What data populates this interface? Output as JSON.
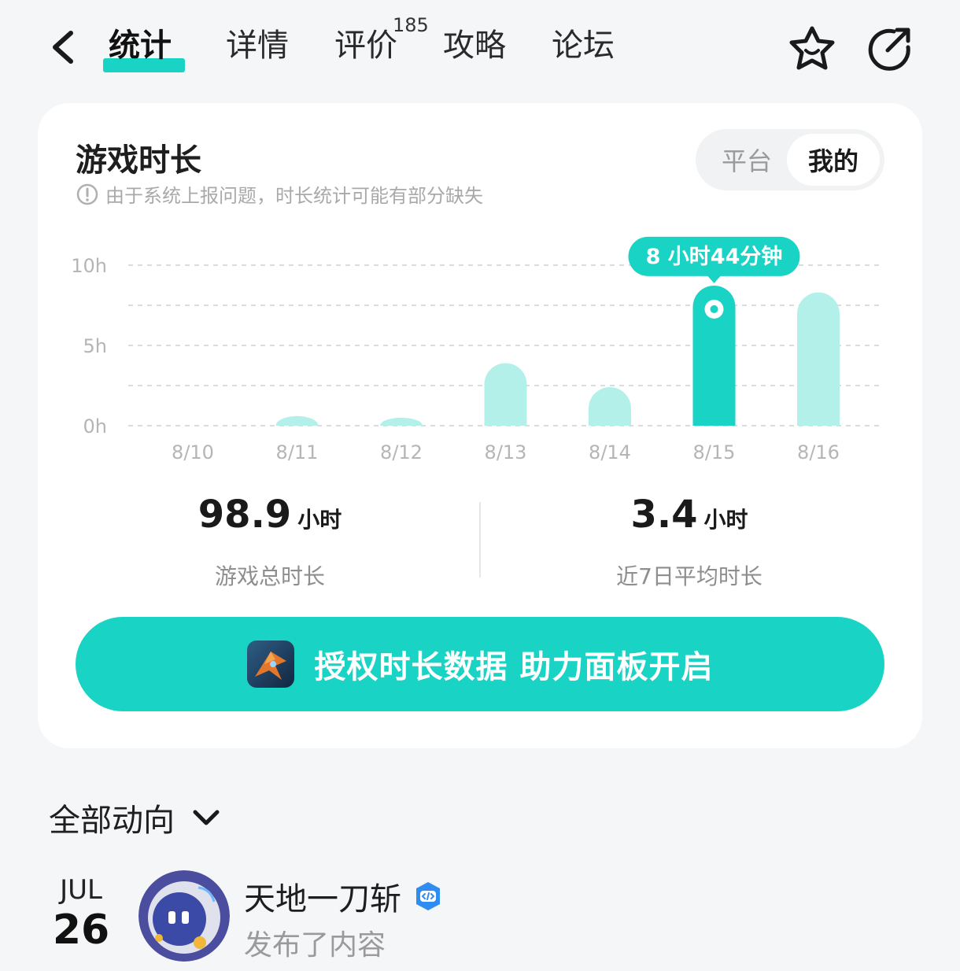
{
  "nav": {
    "tabs": [
      {
        "label": "统计"
      },
      {
        "label": "详情"
      },
      {
        "label": "评价"
      },
      {
        "label": "攻略"
      },
      {
        "label": "论坛"
      }
    ],
    "review_count": "185",
    "icons": [
      "back-arrow-icon",
      "star-face-icon",
      "share-icon"
    ]
  },
  "card": {
    "title": "游戏时长",
    "note": "由于系统上报问题，时长统计可能有部分缺失",
    "segment": {
      "platform": "平台",
      "mine": "我的",
      "selected": "我的"
    }
  },
  "chart_data": {
    "type": "bar",
    "categories": [
      "8/10",
      "8/11",
      "8/12",
      "8/13",
      "8/14",
      "8/15",
      "8/16"
    ],
    "values": [
      0,
      0.6,
      0.5,
      3.9,
      2.4,
      8.73,
      8.3
    ],
    "yticks": [
      "10h",
      "5h",
      "0h"
    ],
    "ylim": [
      0,
      10
    ],
    "highlight_index": 5,
    "highlight_label": "8 小时44分钟",
    "colors": {
      "bar": "#b4f0ea",
      "bar_active": "#19d3c5",
      "grid": "#dcdcdc"
    }
  },
  "stats": [
    {
      "value": "98.9",
      "unit": "小时",
      "label": "游戏总时长"
    },
    {
      "value": "3.4",
      "unit": "小时",
      "label": "近7日平均时长"
    }
  ],
  "cta": {
    "label": "授权时长数据 助力面板开启",
    "icon": "game-app-icon"
  },
  "activity": {
    "filter_label": "全部动向",
    "items": [
      {
        "month": "JUL",
        "day": "26",
        "author": "天地一刀斩",
        "action": "发布了内容",
        "badge": "developer-verified-icon"
      }
    ]
  },
  "colors": {
    "accent": "#19d3c5",
    "background": "#f5f6f8",
    "card": "#ffffff"
  }
}
